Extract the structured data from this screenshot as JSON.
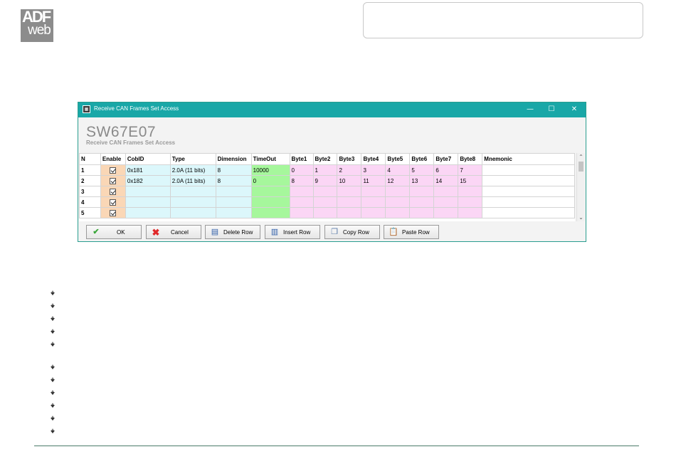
{
  "logo": {
    "line1": "ADF",
    "line2": "web"
  },
  "window": {
    "title": "Receive CAN Frames Set Access",
    "minimize": "—",
    "maximize": "☐",
    "close": "✕",
    "heading": "SW67E07",
    "subheading": "Receive CAN Frames Set Access"
  },
  "table": {
    "headers": [
      "N",
      "Enable",
      "CobID",
      "Type",
      "Dimension",
      "TimeOut",
      "Byte1",
      "Byte2",
      "Byte3",
      "Byte4",
      "Byte5",
      "Byte6",
      "Byte7",
      "Byte8",
      "Mnemonic"
    ],
    "rows": [
      {
        "n": "1",
        "enabled": true,
        "cobid": "0x181",
        "type": "2.0A (11 bits)",
        "dimension": "8",
        "timeout": "10000",
        "bytes": [
          "0",
          "1",
          "2",
          "3",
          "4",
          "5",
          "6",
          "7"
        ],
        "mnemonic": ""
      },
      {
        "n": "2",
        "enabled": true,
        "cobid": "0x182",
        "type": "2.0A (11 bits)",
        "dimension": "8",
        "timeout": "0",
        "bytes": [
          "8",
          "9",
          "10",
          "11",
          "12",
          "13",
          "14",
          "15"
        ],
        "mnemonic": ""
      },
      {
        "n": "3",
        "enabled": true,
        "cobid": "",
        "type": "",
        "dimension": "",
        "timeout": "",
        "bytes": [
          "",
          "",
          "",
          "",
          "",
          "",
          "",
          ""
        ],
        "mnemonic": ""
      },
      {
        "n": "4",
        "enabled": true,
        "cobid": "",
        "type": "",
        "dimension": "",
        "timeout": "",
        "bytes": [
          "",
          "",
          "",
          "",
          "",
          "",
          "",
          ""
        ],
        "mnemonic": ""
      },
      {
        "n": "5",
        "enabled": true,
        "cobid": "",
        "type": "",
        "dimension": "",
        "timeout": "",
        "bytes": [
          "",
          "",
          "",
          "",
          "",
          "",
          "",
          ""
        ],
        "mnemonic": ""
      }
    ]
  },
  "buttons": {
    "ok": "OK",
    "cancel": "Cancel",
    "delete_row": "Delete Row",
    "insert_row": "Insert Row",
    "copy_row": "Copy Row",
    "paste_row": "Paste Row"
  },
  "icons": {
    "ok": "checkmark-icon",
    "cancel": "red-x-icon",
    "delete_row": "delete-row-icon",
    "insert_row": "insert-row-icon",
    "copy_row": "copy-icon",
    "paste_row": "paste-icon"
  },
  "colors": {
    "titlebar": "#19a7a7",
    "enable_col": "#fad7b6",
    "cob_type_dim_col": "#dcf7fb",
    "timeout_col": "#a6f79c",
    "byte_cols": "#fbd6f5"
  }
}
